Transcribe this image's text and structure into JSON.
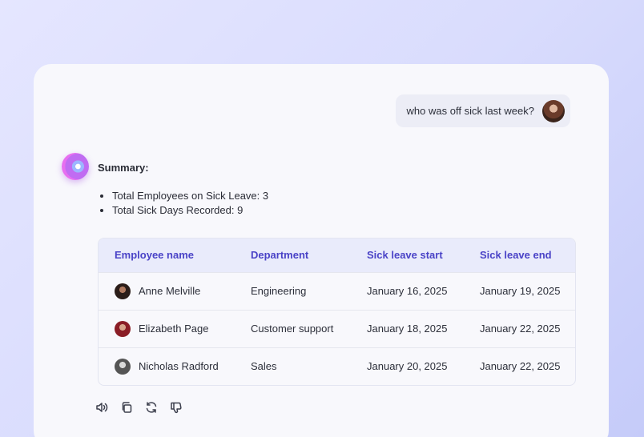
{
  "user_message": "who was off sick last week?",
  "summary": {
    "title": "Summary:",
    "items": [
      "Total Employees on Sick Leave: 3",
      "Total Sick Days Recorded: 9"
    ]
  },
  "table": {
    "headers": [
      "Employee name",
      "Department",
      "Sick leave start",
      "Sick leave end"
    ],
    "rows": [
      {
        "name": "Anne Melville",
        "department": "Engineering",
        "start": "January 16, 2025",
        "end": "January 19, 2025"
      },
      {
        "name": "Elizabeth Page",
        "department": "Customer support",
        "start": "January 18, 2025",
        "end": "January 22, 2025"
      },
      {
        "name": "Nicholas Radford",
        "department": "Sales",
        "start": "January 20, 2025",
        "end": "January 22, 2025"
      }
    ]
  },
  "actions": [
    "speaker-icon",
    "copy-icon",
    "regenerate-icon",
    "thumbs-down-icon"
  ],
  "colors": {
    "accent": "#4a43c7",
    "header_bg": "#e9ebfb",
    "panel_bg": "#f8f8fc"
  }
}
